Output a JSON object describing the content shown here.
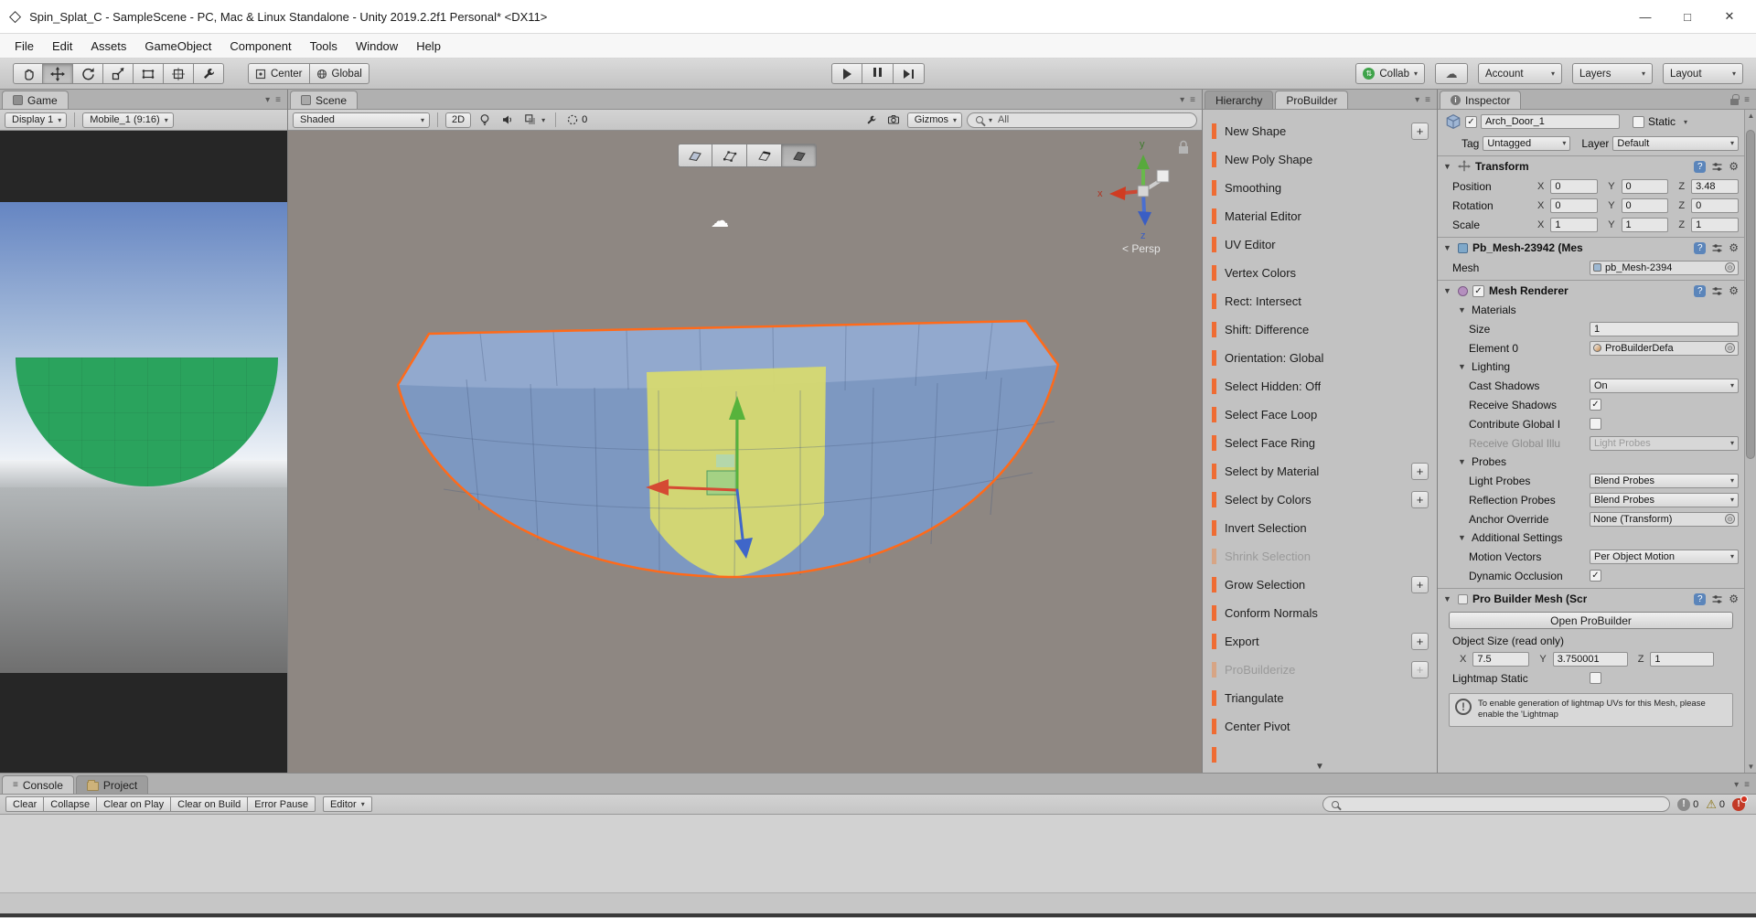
{
  "window": {
    "title": "Spin_Splat_C - SampleScene - PC, Mac & Linux Standalone - Unity 2019.2.2f1 Personal* <DX11>"
  },
  "menubar": {
    "items": [
      "File",
      "Edit",
      "Assets",
      "GameObject",
      "Component",
      "Tools",
      "Window",
      "Help"
    ]
  },
  "toolbar": {
    "pivot": "Center",
    "space": "Global",
    "collab": "Collab",
    "account": "Account",
    "layers": "Layers",
    "layout": "Layout"
  },
  "game": {
    "tab": "Game",
    "display": "Display 1",
    "aspect": "Mobile_1 (9:16)"
  },
  "scene": {
    "tab": "Scene",
    "draw_mode": "Shaded",
    "toggle_2d": "2D",
    "hidden_count": "0",
    "gizmos": "Gizmos",
    "search": "All",
    "persp": "< Persp",
    "axis_x": "x",
    "axis_y": "y",
    "axis_z": "z"
  },
  "probuilder": {
    "tab_hierarchy": "Hierarchy",
    "tab_probuilder": "ProBuilder",
    "accent_color": "#ef6c33",
    "items": [
      {
        "label": "New Shape"
      },
      {
        "label": "New Poly Shape"
      },
      {
        "label": "Smoothing"
      },
      {
        "label": "Material Editor"
      },
      {
        "label": "UV Editor"
      },
      {
        "label": "Vertex Colors"
      },
      {
        "label": "Rect: Intersect"
      },
      {
        "label": "Shift: Difference"
      },
      {
        "label": "Orientation: Global"
      },
      {
        "label": "Select Hidden: Off"
      },
      {
        "label": "Select Face Loop"
      },
      {
        "label": "Select Face Ring"
      },
      {
        "label": "Select by Material"
      },
      {
        "label": "Select by Colors"
      },
      {
        "label": "Invert Selection"
      },
      {
        "label": "Shrink Selection"
      },
      {
        "label": "Grow Selection"
      },
      {
        "label": "Conform Normals"
      },
      {
        "label": "Export"
      },
      {
        "label": "ProBuilderize"
      },
      {
        "label": "Triangulate"
      },
      {
        "label": "Center Pivot"
      }
    ]
  },
  "inspector": {
    "tab": "Inspector",
    "object_name": "Arch_Door_1",
    "static_label": "Static",
    "tag_label": "Tag",
    "tag_value": "Untagged",
    "layer_label": "Layer",
    "layer_value": "Default",
    "axis": {
      "x": "X",
      "y": "Y",
      "z": "Z"
    },
    "transform": {
      "title": "Transform",
      "position_label": "Position",
      "rotation_label": "Rotation",
      "scale_label": "Scale",
      "position": {
        "x": "0",
        "y": "0",
        "z": "3.48"
      },
      "rotation": {
        "x": "0",
        "y": "0",
        "z": "0"
      },
      "scale": {
        "x": "1",
        "y": "1",
        "z": "1"
      }
    },
    "pb_mesh_filter": {
      "title": "Pb_Mesh-23942 (Mes",
      "mesh_label": "Mesh",
      "mesh_value": "pb_Mesh-2394"
    },
    "mesh_renderer": {
      "title": "Mesh Renderer",
      "materials": "Materials",
      "size_label": "Size",
      "size_value": "1",
      "element0_label": "Element 0",
      "element0_value": "ProBuilderDefa",
      "lighting": "Lighting",
      "cast_shadows_label": "Cast Shadows",
      "cast_shadows_value": "On",
      "receive_shadows_label": "Receive Shadows",
      "contribute_gi_label": "Contribute Global I",
      "receive_gi_label": "Receive Global Illu",
      "receive_gi_value": "Light Probes",
      "probes": "Probes",
      "light_probes_label": "Light Probes",
      "light_probes_value": "Blend Probes",
      "reflection_probes_label": "Reflection Probes",
      "reflection_probes_value": "Blend Probes",
      "anchor_label": "Anchor Override",
      "anchor_value": "None (Transform)",
      "additional": "Additional Settings",
      "motion_vectors_label": "Motion Vectors",
      "motion_vectors_value": "Per Object Motion",
      "dynamic_occlusion_label": "Dynamic Occlusion"
    },
    "pro_builder_mesh": {
      "title": "Pro Builder Mesh (Scr",
      "open_button": "Open ProBuilder",
      "object_size_label": "Object Size (read only)",
      "size": {
        "x": "7.5",
        "y": "3.750001",
        "z": "1"
      },
      "lightmap_label": "Lightmap Static",
      "warning": "To enable generation of lightmap UVs for this Mesh, please enable the 'Lightmap"
    }
  },
  "console": {
    "tab_console": "Console",
    "tab_project": "Project",
    "buttons": [
      "Clear",
      "Collapse",
      "Clear on Play",
      "Clear on Build",
      "Error Pause"
    ],
    "editor": "Editor",
    "info_count": "0",
    "warning_count": "0"
  }
}
